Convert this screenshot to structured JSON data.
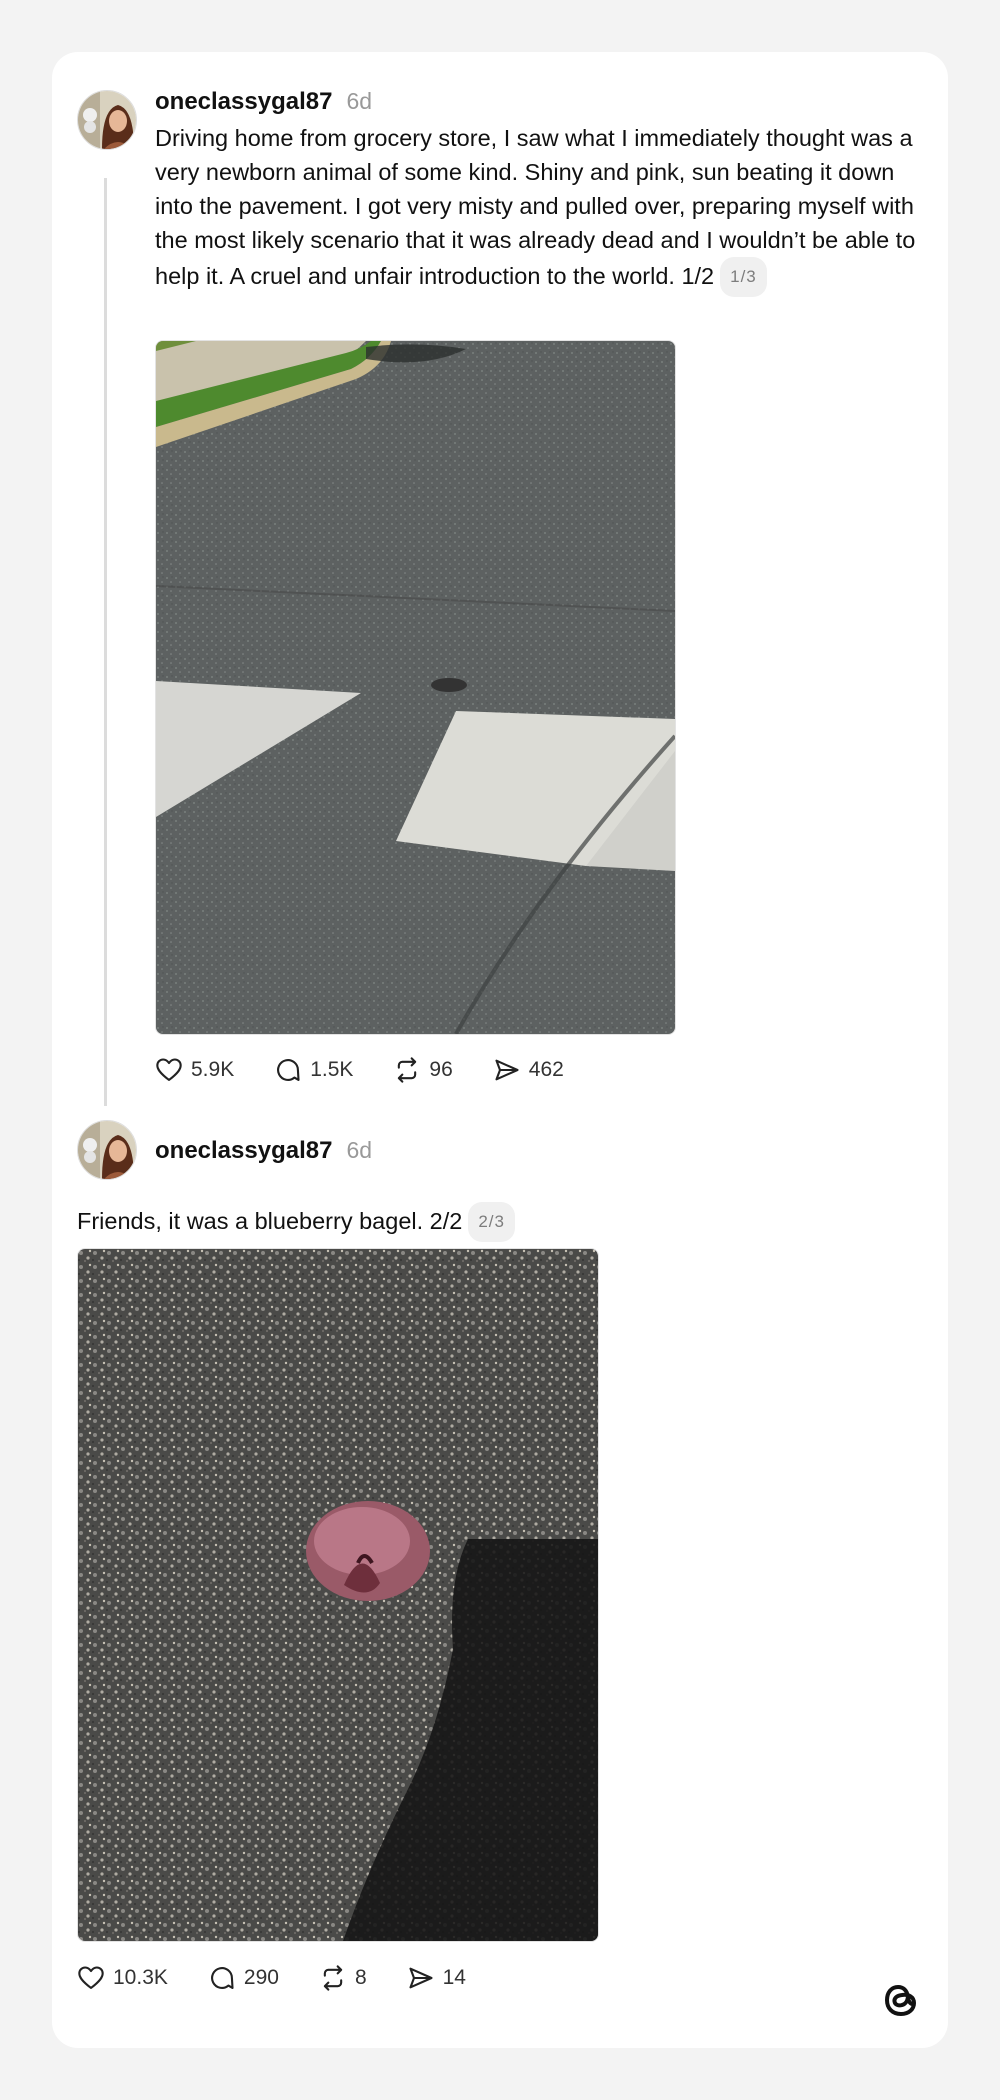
{
  "post1": {
    "username": "oneclassygal87",
    "time": "6d",
    "text": "Driving home from grocery store, I saw what I immediately thought was a very newborn animal of some kind. Shiny and pink, sun beating it down into the pavement. I got very misty and pulled over, preparing myself with the most likely scenario that it was already dead and I wouldn’t be able to help it. A cruel and unfair introduction to the world. 1/2",
    "counter": "1/3",
    "image_alt": "Asphalt road with crosswalk stripes and a small object on the pavement",
    "stats": {
      "likes": "5.9K",
      "replies": "1.5K",
      "reposts": "96",
      "shares": "462"
    }
  },
  "post2": {
    "username": "oneclassygal87",
    "time": "6d",
    "text": "Friends, it was a blueberry bagel. 2/2",
    "counter": "2/3",
    "image_alt": "Close-up of a pink blueberry bagel lying on gravelly asphalt with a shadow",
    "stats": {
      "likes": "10.3K",
      "replies": "290",
      "reposts": "8",
      "shares": "14"
    }
  },
  "icons": {
    "like": "heart-icon",
    "reply": "comment-icon",
    "repost": "repost-icon",
    "share": "share-icon",
    "brand": "threads-logo-icon"
  },
  "colors": {
    "background": "#f3f3f3",
    "card": "#ffffff",
    "muted": "#999999",
    "text": "#111111"
  }
}
